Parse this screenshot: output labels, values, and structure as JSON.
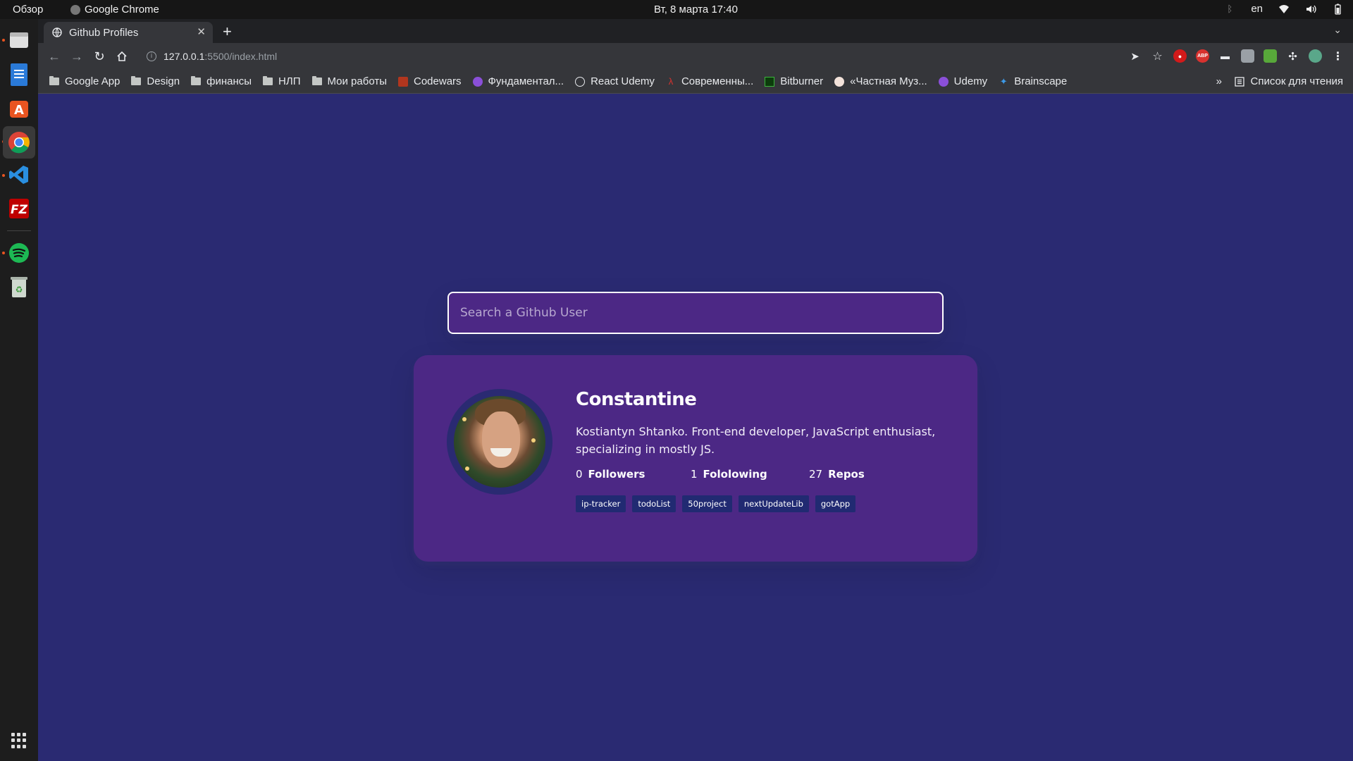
{
  "system": {
    "activities": "Обзор",
    "app_name": "Google Chrome",
    "clock": "Вт, 8 марта  17:40",
    "lang": "en"
  },
  "browser": {
    "tab_title": "Github Profiles",
    "url_host": "127.0.0.1",
    "url_rest": ":5500/index.html",
    "bookmarks": [
      {
        "label": "Google App",
        "icon": "folder-icon"
      },
      {
        "label": "Design",
        "icon": "folder-icon"
      },
      {
        "label": "финансы",
        "icon": "folder-icon"
      },
      {
        "label": "НЛП",
        "icon": "folder-icon"
      },
      {
        "label": "Мои работы",
        "icon": "folder-icon"
      },
      {
        "label": "Codewars",
        "icon": "codewars-icon"
      },
      {
        "label": "Фундаментал...",
        "icon": "udemy-icon"
      },
      {
        "label": "React Udemy",
        "icon": "globe-icon"
      },
      {
        "label": "Современны...",
        "icon": "javascript-info-icon"
      },
      {
        "label": "Bitburner",
        "icon": "bitburner-icon"
      },
      {
        "label": "«Частная Муз...",
        "icon": "music-icon"
      },
      {
        "label": "Udemy",
        "icon": "udemy-icon"
      },
      {
        "label": "Brainscape",
        "icon": "brainscape-icon"
      }
    ],
    "bookmarks_more": "»",
    "reading_list": "Список для чтения"
  },
  "search": {
    "placeholder": "Search a Github User"
  },
  "profile": {
    "name": "Constantine",
    "bio": "Kostiantyn Shtanko. Front-end developer, JavaScript enthusiast, specializing in mostly JS.",
    "followers_count": "0",
    "followers_label": "Followers",
    "following_count": "1",
    "following_label": "Fololowing",
    "repos_count": "27",
    "repos_label": "Repos",
    "repos": [
      "ip-tracker",
      "todoList",
      "50project",
      "nextUpdateLib",
      "gotApp"
    ]
  },
  "colors": {
    "page_bg": "#2a2a72",
    "card_bg": "#4c2885",
    "repo_bg": "#212a72"
  }
}
